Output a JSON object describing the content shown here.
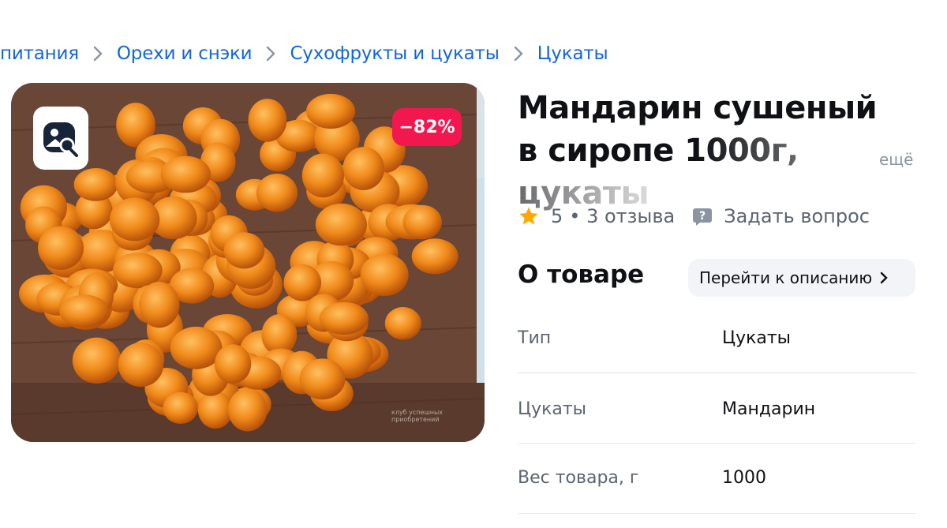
{
  "breadcrumb": [
    "питания",
    "Орехи и снэки",
    "Сухофрукты и цукаты",
    "Цукаты"
  ],
  "product": {
    "discount": "−82%",
    "title": "Мандарин сушеный в сиропе 1000г, цукаты",
    "more_label": "ещё",
    "rating": "5",
    "reviews": "• 3 отзыва",
    "ask_label": "Задать вопрос"
  },
  "about": {
    "title": "О товаре",
    "goto_label": "Перейти к описанию",
    "specs": [
      {
        "key": "Тип",
        "value": "Цукаты"
      },
      {
        "key": "Цукаты",
        "value": "Мандарин"
      },
      {
        "key": "Вес товара, г",
        "value": "1000"
      }
    ]
  },
  "photo_watermark": "клуб успешных приобретений",
  "icons": {
    "star": "star-icon",
    "question": "question-icon",
    "chevron": "chevron-right-icon",
    "search": "image-search-icon"
  },
  "colors": {
    "link": "#1166dd",
    "accent": "#f2184f",
    "star": "#ffa800"
  }
}
